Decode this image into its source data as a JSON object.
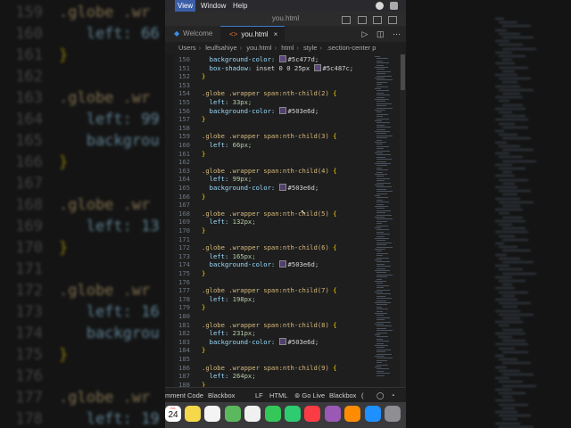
{
  "menubar": {
    "items": [
      "View",
      "Window",
      "Help"
    ],
    "active_index": 0
  },
  "window": {
    "title": "you.html"
  },
  "tabs": [
    {
      "label": "Welcome",
      "active": false
    },
    {
      "label": "you.html",
      "active": true,
      "close": "×"
    }
  ],
  "breadcrumb": [
    "Users",
    "leulfsahiye",
    "you.html",
    "html",
    "style",
    ".section-center p"
  ],
  "editor": {
    "lines": [
      {
        "n": "150",
        "parts": [
          [
            "  background-color: ",
            "prop"
          ],
          [
            "swatch",
            "#5c477d"
          ],
          [
            "#5c477d;",
            "txt"
          ]
        ]
      },
      {
        "n": "151",
        "parts": [
          [
            "  box-shadow: ",
            "prop"
          ],
          [
            "inset 0 0 25px ",
            "txt"
          ],
          [
            "swatch",
            "#5c487c"
          ],
          [
            "#5c487c;",
            "txt"
          ]
        ]
      },
      {
        "n": "152",
        "parts": [
          [
            "}",
            "brace"
          ]
        ]
      },
      {
        "n": "153",
        "parts": []
      },
      {
        "n": "154",
        "parts": [
          [
            ".globe .wrapper span:nth-child(2) ",
            "sel"
          ],
          [
            "{",
            "brace"
          ]
        ]
      },
      {
        "n": "155",
        "parts": [
          [
            "  left: ",
            "prop"
          ],
          [
            "33px;",
            "num"
          ]
        ]
      },
      {
        "n": "156",
        "parts": [
          [
            "  background-color: ",
            "prop"
          ],
          [
            "swatch",
            "#503e6d"
          ],
          [
            "#503e6d;",
            "txt"
          ]
        ]
      },
      {
        "n": "157",
        "parts": [
          [
            "}",
            "brace"
          ]
        ]
      },
      {
        "n": "158",
        "parts": []
      },
      {
        "n": "159",
        "parts": [
          [
            ".globe .wrapper span:nth-child(3) ",
            "sel"
          ],
          [
            "{",
            "brace"
          ]
        ]
      },
      {
        "n": "160",
        "parts": [
          [
            "  left: ",
            "prop"
          ],
          [
            "66px;",
            "num"
          ]
        ]
      },
      {
        "n": "161",
        "parts": [
          [
            "}",
            "brace"
          ]
        ]
      },
      {
        "n": "162",
        "parts": []
      },
      {
        "n": "163",
        "parts": [
          [
            ".globe .wrapper span:nth-child(4) ",
            "sel"
          ],
          [
            "{",
            "brace"
          ]
        ]
      },
      {
        "n": "164",
        "parts": [
          [
            "  left: ",
            "prop"
          ],
          [
            "99px;",
            "num"
          ]
        ]
      },
      {
        "n": "165",
        "parts": [
          [
            "  background-color: ",
            "prop"
          ],
          [
            "swatch",
            "#503e6d"
          ],
          [
            "#503e6d;",
            "txt"
          ]
        ]
      },
      {
        "n": "166",
        "parts": [
          [
            "}",
            "brace"
          ]
        ]
      },
      {
        "n": "167",
        "parts": []
      },
      {
        "n": "168",
        "parts": [
          [
            ".globe .wrapper span:nth-child(5) ",
            "sel"
          ],
          [
            "{",
            "brace"
          ]
        ]
      },
      {
        "n": "169",
        "parts": [
          [
            "  left: ",
            "prop"
          ],
          [
            "132px;",
            "num"
          ]
        ]
      },
      {
        "n": "170",
        "parts": [
          [
            "}",
            "brace"
          ]
        ]
      },
      {
        "n": "171",
        "parts": []
      },
      {
        "n": "172",
        "parts": [
          [
            ".globe .wrapper span:nth-child(6) ",
            "sel"
          ],
          [
            "{",
            "brace"
          ]
        ]
      },
      {
        "n": "173",
        "parts": [
          [
            "  left: ",
            "prop"
          ],
          [
            "165px;",
            "num"
          ]
        ]
      },
      {
        "n": "174",
        "parts": [
          [
            "  background-color: ",
            "prop"
          ],
          [
            "swatch",
            "#503e6d"
          ],
          [
            "#503e6d;",
            "txt"
          ]
        ]
      },
      {
        "n": "175",
        "parts": [
          [
            "}",
            "brace"
          ]
        ]
      },
      {
        "n": "176",
        "parts": []
      },
      {
        "n": "177",
        "parts": [
          [
            ".globe .wrapper span:nth-child(7) ",
            "sel"
          ],
          [
            "{",
            "brace"
          ]
        ]
      },
      {
        "n": "178",
        "parts": [
          [
            "  left: ",
            "prop"
          ],
          [
            "198px;",
            "num"
          ]
        ]
      },
      {
        "n": "179",
        "parts": [
          [
            "}",
            "brace"
          ]
        ]
      },
      {
        "n": "180",
        "parts": []
      },
      {
        "n": "181",
        "parts": [
          [
            ".globe .wrapper span:nth-child(8) ",
            "sel"
          ],
          [
            "{",
            "brace"
          ]
        ]
      },
      {
        "n": "182",
        "parts": [
          [
            "  left: ",
            "prop"
          ],
          [
            "231px;",
            "num"
          ]
        ]
      },
      {
        "n": "183",
        "parts": [
          [
            "  background-color: ",
            "prop"
          ],
          [
            "swatch",
            "#503e6d"
          ],
          [
            "#503e6d;",
            "txt"
          ]
        ]
      },
      {
        "n": "184",
        "parts": [
          [
            "}",
            "brace"
          ]
        ]
      },
      {
        "n": "185",
        "parts": []
      },
      {
        "n": "186",
        "parts": [
          [
            ".globe .wrapper span:nth-child(9) ",
            "sel"
          ],
          [
            "{",
            "brace"
          ]
        ]
      },
      {
        "n": "187",
        "parts": [
          [
            "  left: ",
            "prop"
          ],
          [
            "264px;",
            "num"
          ]
        ]
      },
      {
        "n": "188",
        "parts": [
          [
            "}",
            "brace"
          ]
        ]
      }
    ]
  },
  "statusbar": {
    "items": [
      "mment Code",
      "Blackbox",
      "LF",
      "HTML",
      "Go Live",
      "Blackbox",
      "("
    ]
  },
  "dock": {
    "calendar_month": "JUL",
    "calendar_day": "24",
    "icons": [
      "calendar-icon",
      "notes-icon",
      "reminders-icon",
      "maps-icon",
      "photos-icon",
      "messages-icon",
      "facetime-icon",
      "music-icon",
      "podcasts-icon",
      "books-icon",
      "app-store-icon",
      "settings-icon"
    ]
  },
  "background": {
    "left_lines": [
      {
        "n": "159",
        "t": ".globe .wr"
      },
      {
        "n": "160",
        "t": "   left: 66"
      },
      {
        "n": "161",
        "t": "}"
      },
      {
        "n": "162",
        "t": ""
      },
      {
        "n": "163",
        "t": ".globe .wr"
      },
      {
        "n": "164",
        "t": "   left: 99"
      },
      {
        "n": "165",
        "t": "   backgrou"
      },
      {
        "n": "166",
        "t": "}"
      },
      {
        "n": "167",
        "t": ""
      },
      {
        "n": "168",
        "t": ".globe .wr"
      },
      {
        "n": "169",
        "t": "   left: 13"
      },
      {
        "n": "170",
        "t": "}"
      },
      {
        "n": "171",
        "t": ""
      },
      {
        "n": "172",
        "t": ".globe .wr"
      },
      {
        "n": "173",
        "t": "   left: 16"
      },
      {
        "n": "174",
        "t": "   backgrou"
      },
      {
        "n": "175",
        "t": "}"
      },
      {
        "n": "176",
        "t": ""
      },
      {
        "n": "177",
        "t": ".globe .wr"
      },
      {
        "n": "178",
        "t": "   left: 19"
      }
    ]
  },
  "colors": {
    "accent": "#3a7bd5",
    "editor_bg": "#1e1e1e",
    "selector": "#d7ba7d",
    "property": "#9cdcfe",
    "number": "#b5cea8"
  }
}
